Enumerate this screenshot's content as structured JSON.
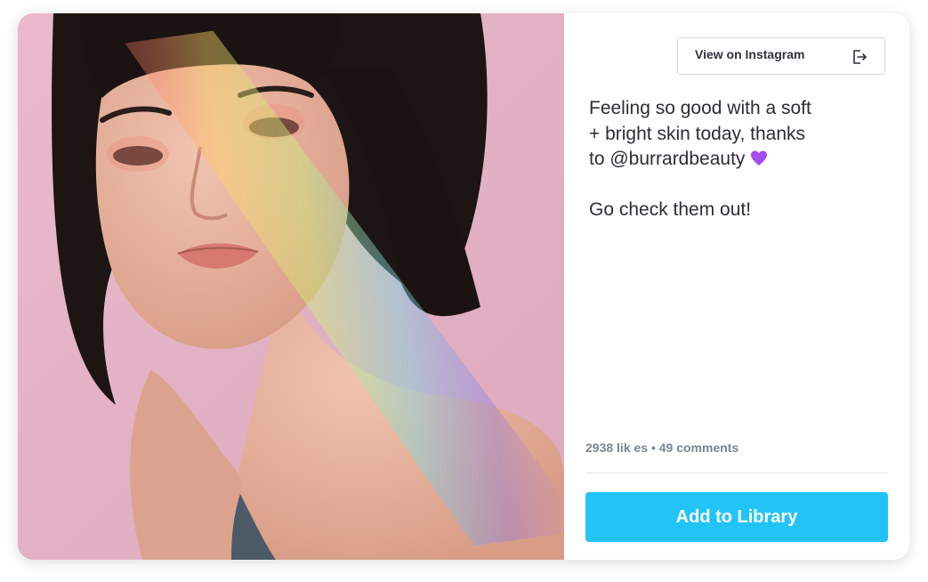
{
  "post": {
    "view_on_instagram_label": "View on Instagram",
    "caption_line1": "Feeling so good with a soft",
    "caption_line2": "+ bright skin today, thanks",
    "caption_line3": "to @burrardbeauty",
    "caption_line4": "Go check them out!",
    "emoji_icon": "purple-heart-icon",
    "stats": "2938 lik  es • 49 comments",
    "add_button_label": "Add to Library"
  },
  "colors": {
    "accent": "#22c4f8",
    "photo_background": "#e6b7c9",
    "heart": "#a54cf0"
  }
}
